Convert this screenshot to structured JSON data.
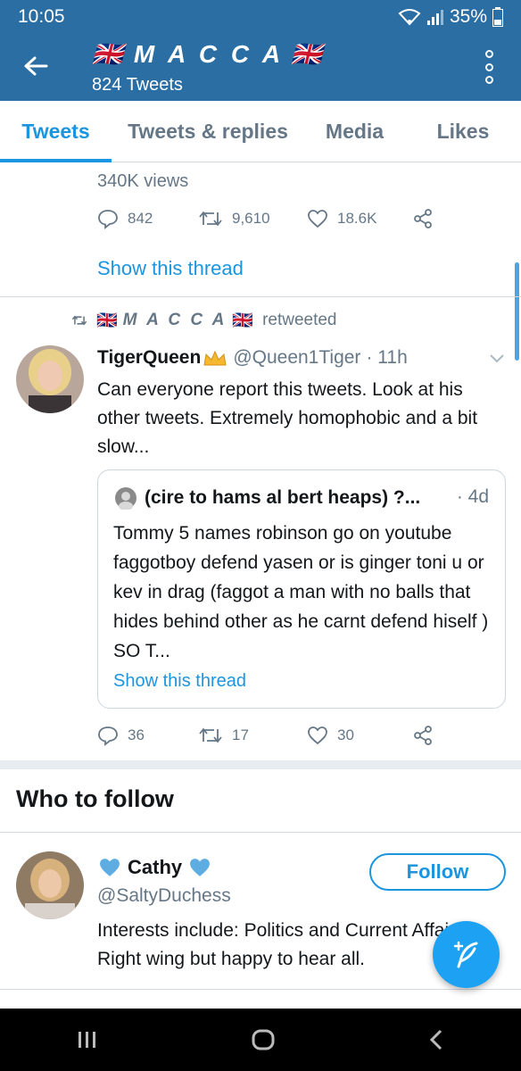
{
  "status": {
    "time": "10:05",
    "battery": "35%"
  },
  "header": {
    "title": "M A C C A",
    "flag": "🇬🇧",
    "subtitle": "824 Tweets"
  },
  "tabs": [
    {
      "label": "Tweets",
      "active": true
    },
    {
      "label": "Tweets & replies",
      "active": false
    },
    {
      "label": "Media",
      "active": false
    },
    {
      "label": "Likes",
      "active": false
    }
  ],
  "prev_tweet": {
    "views": "340K views",
    "replies": "842",
    "retweets": "9,610",
    "likes": "18.6K",
    "show_thread": "Show this thread"
  },
  "tweet": {
    "retweeter": "M A C C A",
    "retweeted_label": "retweeted",
    "author_name": "TigerQueen",
    "author_handle": "@Queen1Tiger",
    "time": "· 11h",
    "body": "Can everyone report this tweets. Look at his other tweets. Extremely homophobic and a bit slow...",
    "quote": {
      "name": "(cire to hams al bert heaps) ?...",
      "time": "· 4d",
      "body": "Tommy 5 names robinson go on youtube faggotboy defend yasen or is ginger toni u or kev in drag (faggot a man with no balls that hides behind other as he carnt defend hiself )  SO T...",
      "show_thread": "Show this thread"
    },
    "replies": "36",
    "retweets": "17",
    "likes": "30"
  },
  "who_to_follow": {
    "title": "Who to follow",
    "user": {
      "name": "Cathy",
      "handle": "@SaltyDuchess",
      "bio": "Interests include: Politics and Current Affairs. Right wing but happy to hear all.",
      "follow_label": "Follow"
    }
  },
  "colors": {
    "header_bg": "#2b6ea3",
    "accent": "#1b95e0",
    "muted": "#657786"
  }
}
